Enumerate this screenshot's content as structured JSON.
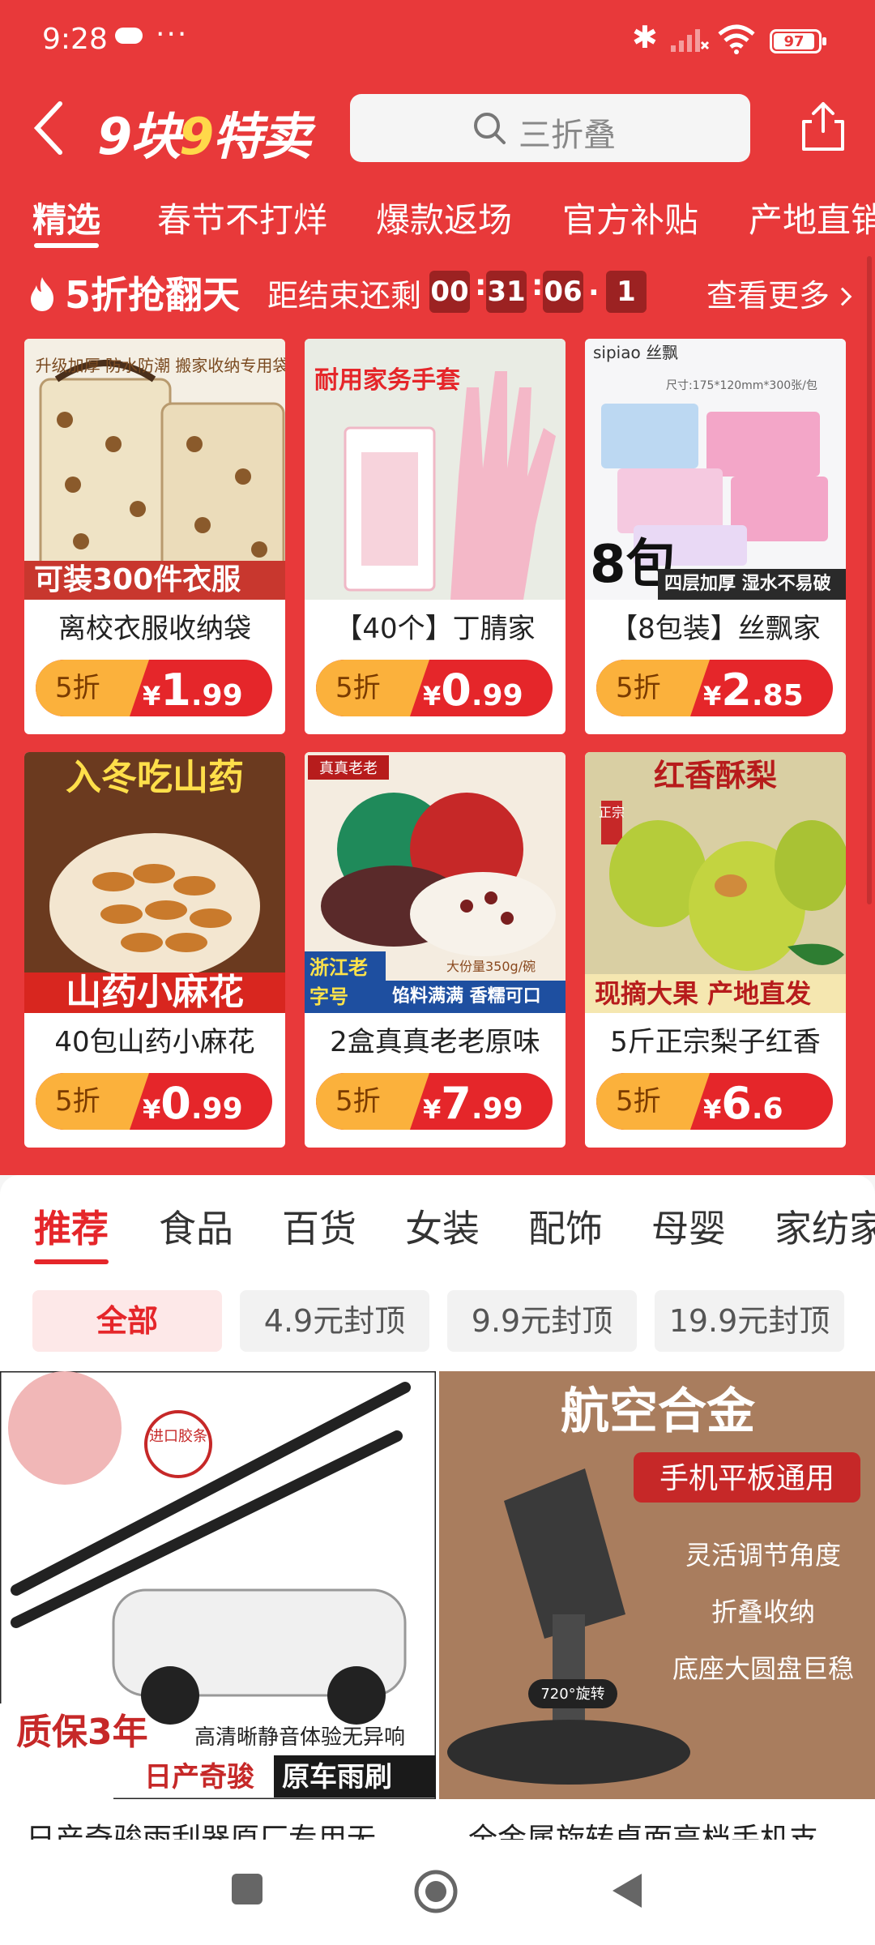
{
  "status": {
    "time": "9:28",
    "dots": "···",
    "battery": "97"
  },
  "header": {
    "search_placeholder": "三折叠"
  },
  "tabs": [
    "精选",
    "春节不打烊",
    "爆款返场",
    "官方补贴",
    "产地直销"
  ],
  "flash": {
    "title": "5折抢翻天",
    "countdown_label": "距结束还剩",
    "hh": "00",
    "mm": "31",
    "ss": "06",
    "tenth": "1",
    "see_more": "查看更多"
  },
  "products": [
    {
      "name": "离校衣服收纳袋",
      "discount": "5折",
      "yen": "¥",
      "int": "1",
      "dec": ".99",
      "banner": "可装300件衣服"
    },
    {
      "name": "【40个】丁腈家",
      "discount": "5折",
      "yen": "¥",
      "int": "0",
      "dec": ".99",
      "banner": "耐用家务手套"
    },
    {
      "name": "【8包装】丝飘家",
      "discount": "5折",
      "yen": "¥",
      "int": "2",
      "dec": ".85",
      "banner": "四层加厚 湿水不易破"
    },
    {
      "name": "40包山药小麻花",
      "discount": "5折",
      "yen": "¥",
      "int": "0",
      "dec": ".99",
      "banner": "山药小麻花"
    },
    {
      "name": "2盒真真老老原味",
      "discount": "5折",
      "yen": "¥",
      "int": "7",
      "dec": ".99",
      "banner": "浙江老字号"
    },
    {
      "name": "5斤正宗梨子红香",
      "discount": "5折",
      "yen": "¥",
      "int": "6",
      "dec": ".6",
      "banner": "现摘大果 产地直发"
    }
  ],
  "image_labels": {
    "p1": "升级加厚 防水防潮 搬家收纳专用袋子",
    "p3_brand": "sipiao 丝飘",
    "p3_size": "尺寸:175*120mm*300张/包",
    "p3_pack": "8包",
    "p4": "入冬吃山药",
    "p5_badge": "真真老老",
    "p5_side": "馅料满满 香糯可口",
    "p5_cap": "大份量350g/碗",
    "p6": "红香酥梨",
    "p6_tag": "正宗"
  },
  "categories": [
    "推荐",
    "食品",
    "百货",
    "女装",
    "配饰",
    "母婴",
    "家纺家"
  ],
  "filters": [
    "全部",
    "4.9元封顶",
    "9.9元封顶",
    "19.9元封顶"
  ],
  "feed": [
    {
      "name": "日产奇骏雨刮器原厂专用无",
      "tag": "进口胶条",
      "quality": "质保3年",
      "caption": "高清晰静音体验无异响",
      "brand": "日产奇骏",
      "type": "原车雨刷"
    },
    {
      "name": "全金属旋转桌面高档手机支",
      "title": "航空合金",
      "subtitle": "手机平板通用",
      "f1": "灵活调节角度",
      "f2": "折叠收纳",
      "f3": "底座大圆盘巨稳",
      "rotate": "720°旋转"
    }
  ]
}
